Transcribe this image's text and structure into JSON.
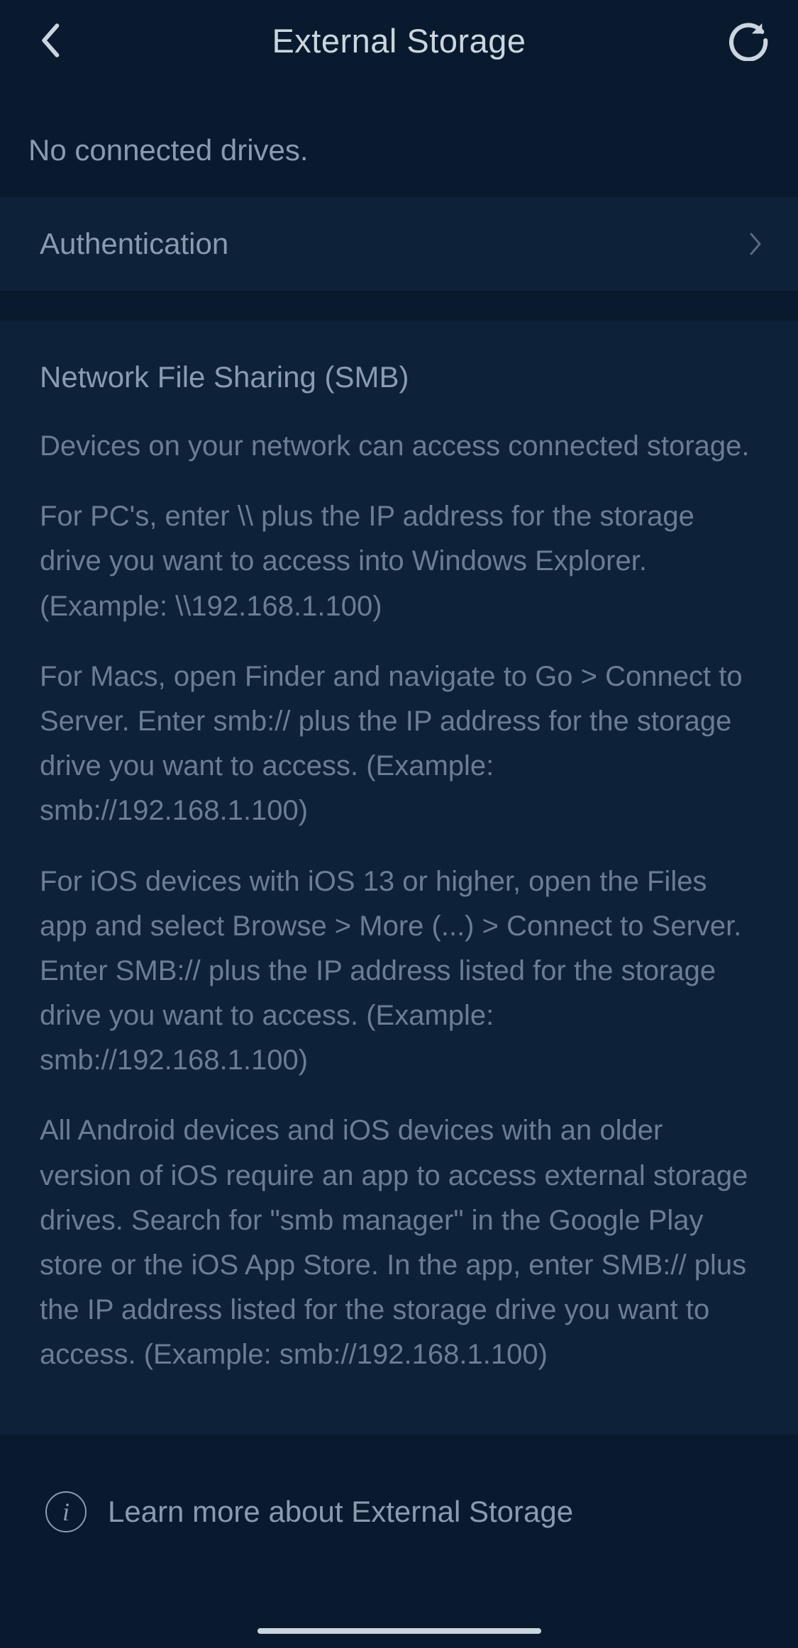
{
  "header": {
    "title": "External Storage"
  },
  "status": {
    "no_drives": "No connected drives."
  },
  "menu": {
    "authentication": "Authentication"
  },
  "smb": {
    "title": "Network File Sharing (SMB)",
    "desc": "Devices on your network can access connected storage.",
    "pc": "For PC's, enter \\\\ plus the IP address for the storage drive you want to access into Windows Explorer. (Example: \\\\192.168.1.100)",
    "mac": "For Macs, open Finder and navigate to Go > Connect to Server. Enter smb:// plus the IP address for the storage drive you want to access. (Example: smb://192.168.1.100)",
    "ios": "For iOS devices with iOS 13 or higher, open the Files app and select Browse > More (...) > Connect to Server. Enter SMB:// plus the IP address listed for the storage drive you want to access. (Example: smb://192.168.1.100)",
    "android": "All Android devices and iOS devices with an older version of iOS require an app to access external storage drives. Search for \"smb manager\" in the Google Play store or the iOS App Store. In the app, enter SMB:// plus the IP address listed for the storage drive you want to access. (Example: smb://192.168.1.100)"
  },
  "learn_more": {
    "label": "Learn more about External Storage"
  }
}
